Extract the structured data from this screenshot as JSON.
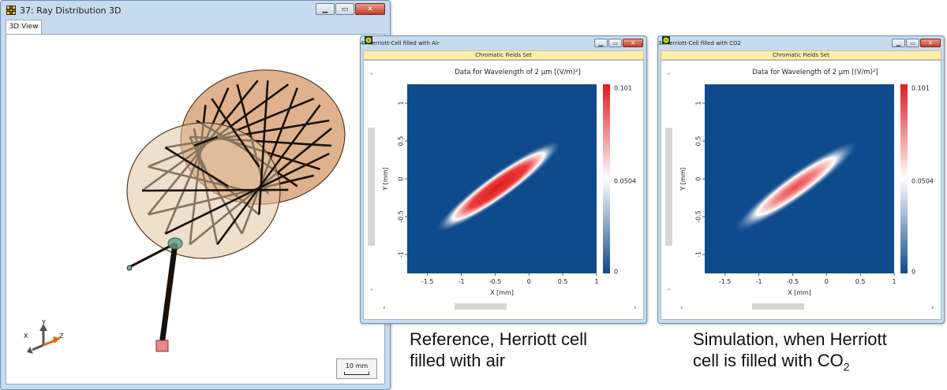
{
  "window_3d": {
    "title": "37: Ray Distribution 3D",
    "tab_label": "3D View",
    "scale_label": "10 mm",
    "axes": {
      "x": "X",
      "y": "Y",
      "z": "Z"
    }
  },
  "window_air": {
    "title": "4: Herriott-Cell filled with Air",
    "banner": "Chromatic Fields Set",
    "plot_title": "Data for Wavelength of 2 µm  [(V/m)²]",
    "xlabel": "X [mm]",
    "ylabel": "Y [mm]",
    "x_ticks": [
      "-1.5",
      "-1",
      "-0.5",
      "0",
      "0.5",
      "1"
    ],
    "y_ticks": [
      "1",
      "0.5",
      "0",
      "-0.5",
      "-1"
    ],
    "colorbar_ticks": [
      "0.101",
      "0.0504",
      "0"
    ]
  },
  "window_co2": {
    "title": "3: Herriott-Cell filled with CO2",
    "banner": "Chromatic Fields Set",
    "plot_title": "Data for Wavelength of 2 µm  [(V/m)²]",
    "xlabel": "X [mm]",
    "ylabel": "Y [mm]",
    "x_ticks": [
      "-1.5",
      "-1",
      "-0.5",
      "0",
      "0.5",
      "1"
    ],
    "y_ticks": [
      "1",
      "0.5",
      "0",
      "-0.5",
      "-1"
    ],
    "colorbar_ticks": [
      "0.101",
      "0.0504",
      "0"
    ]
  },
  "captions": {
    "air_line1": "Reference, Herriott cell",
    "air_line2": "filled with air",
    "co2_line1": "Simulation, when Herriott",
    "co2_line2_prefix": "cell is filled with CO",
    "co2_line2_sub": "2"
  },
  "colors": {
    "field_background": "#0f4a8c",
    "beam_hot": "#e11b22",
    "beam_edge": "#ffffff",
    "mirror_fill": "#d9a77e",
    "ray_color": "#1b1108",
    "banner": "#ffeeb0",
    "window_frame": "#c7dbef"
  },
  "icons": {
    "app": "grid-app-icon",
    "minimize": "minimize-icon",
    "maximize": "maximize-icon",
    "close": "close-icon"
  }
}
